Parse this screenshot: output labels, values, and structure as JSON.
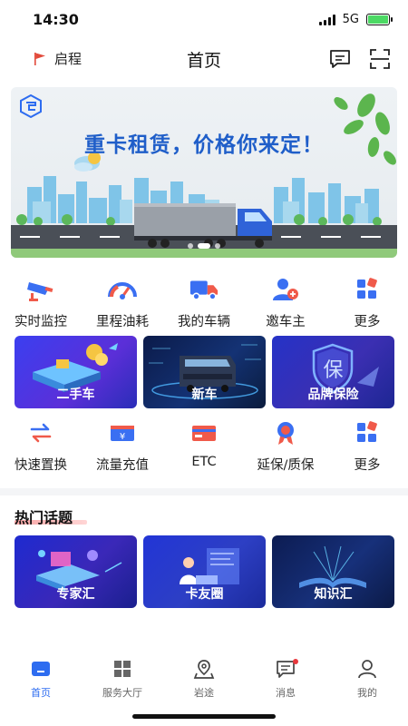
{
  "status_bar": {
    "time": "14:30",
    "network": "5G"
  },
  "header": {
    "location": "启程",
    "title": "首页"
  },
  "banner": {
    "headline": "重卡租赁，价格你来定！"
  },
  "quick_menu": [
    {
      "label": "实时监控",
      "icon": "camera-icon"
    },
    {
      "label": "里程油耗",
      "icon": "gauge-icon"
    },
    {
      "label": "我的车辆",
      "icon": "truck-icon"
    },
    {
      "label": "邀车主",
      "icon": "invite-user-icon"
    },
    {
      "label": "更多",
      "icon": "grid-more-icon"
    }
  ],
  "feature_cards": [
    {
      "label": "二手车"
    },
    {
      "label": "新车"
    },
    {
      "label": "品牌保险",
      "badge": "保"
    }
  ],
  "service_menu": [
    {
      "label": "快速置换",
      "icon": "swap-icon"
    },
    {
      "label": "流量充值",
      "icon": "yen-card-icon"
    },
    {
      "label": "ETC",
      "icon": "etc-card-icon"
    },
    {
      "label": "延保/质保",
      "icon": "ribbon-icon"
    },
    {
      "label": "更多",
      "icon": "grid-more-icon"
    }
  ],
  "hot_topics": {
    "title": "热门话题",
    "cards": [
      {
        "label": "专家汇"
      },
      {
        "label": "卡友圈"
      },
      {
        "label": "知识汇"
      }
    ]
  },
  "tabbar": [
    {
      "label": "首页",
      "icon": "home-icon",
      "active": true
    },
    {
      "label": "服务大厅",
      "icon": "service-grid-icon",
      "active": false
    },
    {
      "label": "岩途",
      "icon": "map-pin-icon",
      "active": false
    },
    {
      "label": "消息",
      "icon": "message-icon",
      "active": false,
      "has_badge": true
    },
    {
      "label": "我的",
      "icon": "profile-icon",
      "active": false
    }
  ],
  "colors": {
    "accent": "#2d6cf0",
    "badge": "#e8383d",
    "banner_title": "#1f5ec9",
    "icon_blue": "#3a6ff2",
    "icon_red": "#f05a4a"
  }
}
